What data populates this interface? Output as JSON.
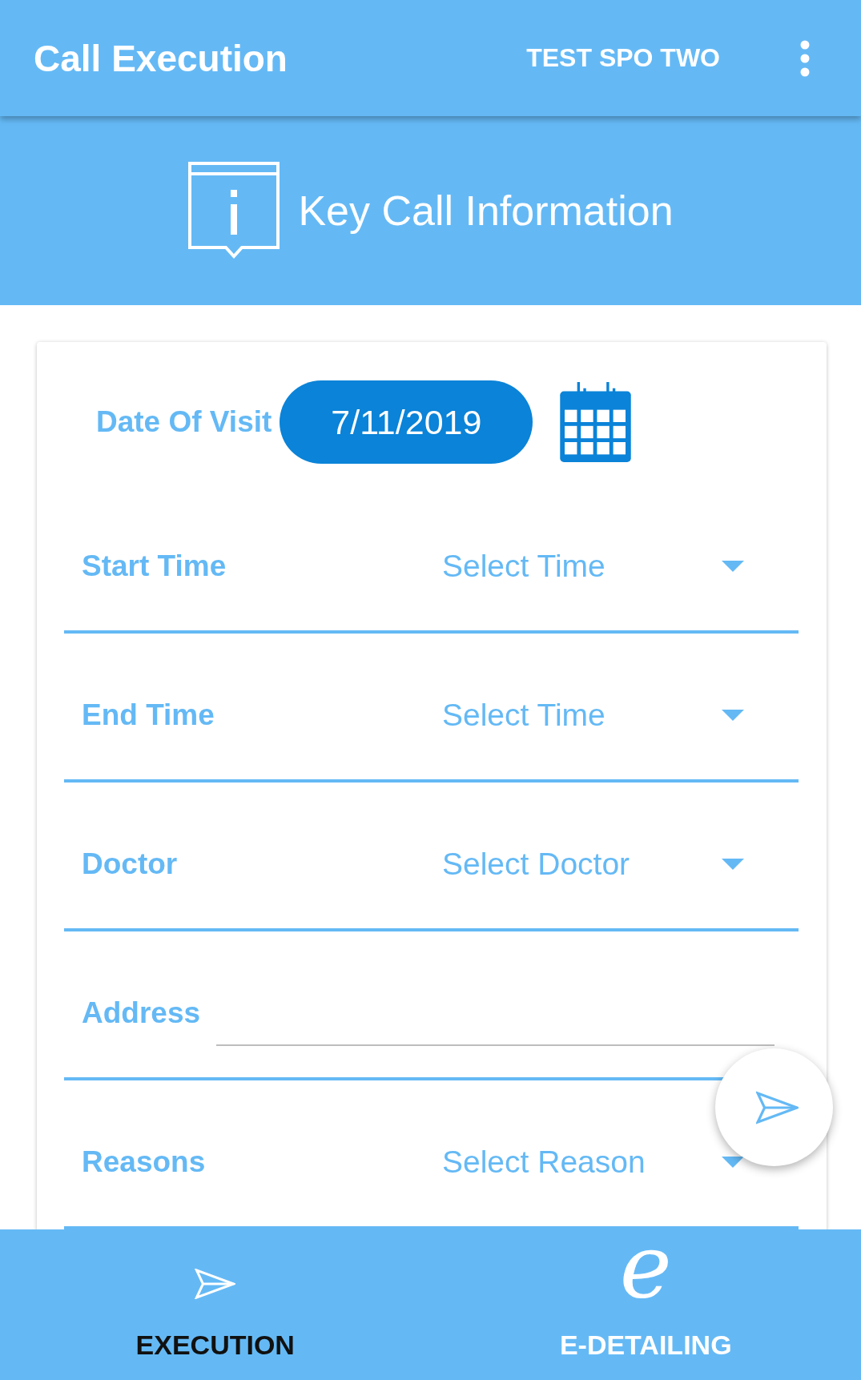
{
  "app_bar": {
    "title": "Call Execution",
    "user": "TEST SPO TWO"
  },
  "banner": {
    "title": "Key Call Information"
  },
  "form": {
    "date": {
      "label": "Date Of Visit",
      "value": "7/11/2019"
    },
    "fields": [
      {
        "kind": "dropdown",
        "label": "Start Time",
        "placeholder": "Select Time"
      },
      {
        "kind": "dropdown",
        "label": "End Time",
        "placeholder": "Select Time"
      },
      {
        "kind": "dropdown",
        "label": "Doctor",
        "placeholder": "Select Doctor"
      },
      {
        "kind": "text",
        "label": "Address"
      },
      {
        "kind": "dropdown",
        "label": "Reasons",
        "placeholder": "Select Reason"
      }
    ]
  },
  "bottom_nav": [
    {
      "kind": "plane",
      "label": "EXECUTION",
      "selected": true
    },
    {
      "kind": "glyph",
      "glyph": "e",
      "label": "E-DETAILING",
      "selected": false
    }
  ]
}
